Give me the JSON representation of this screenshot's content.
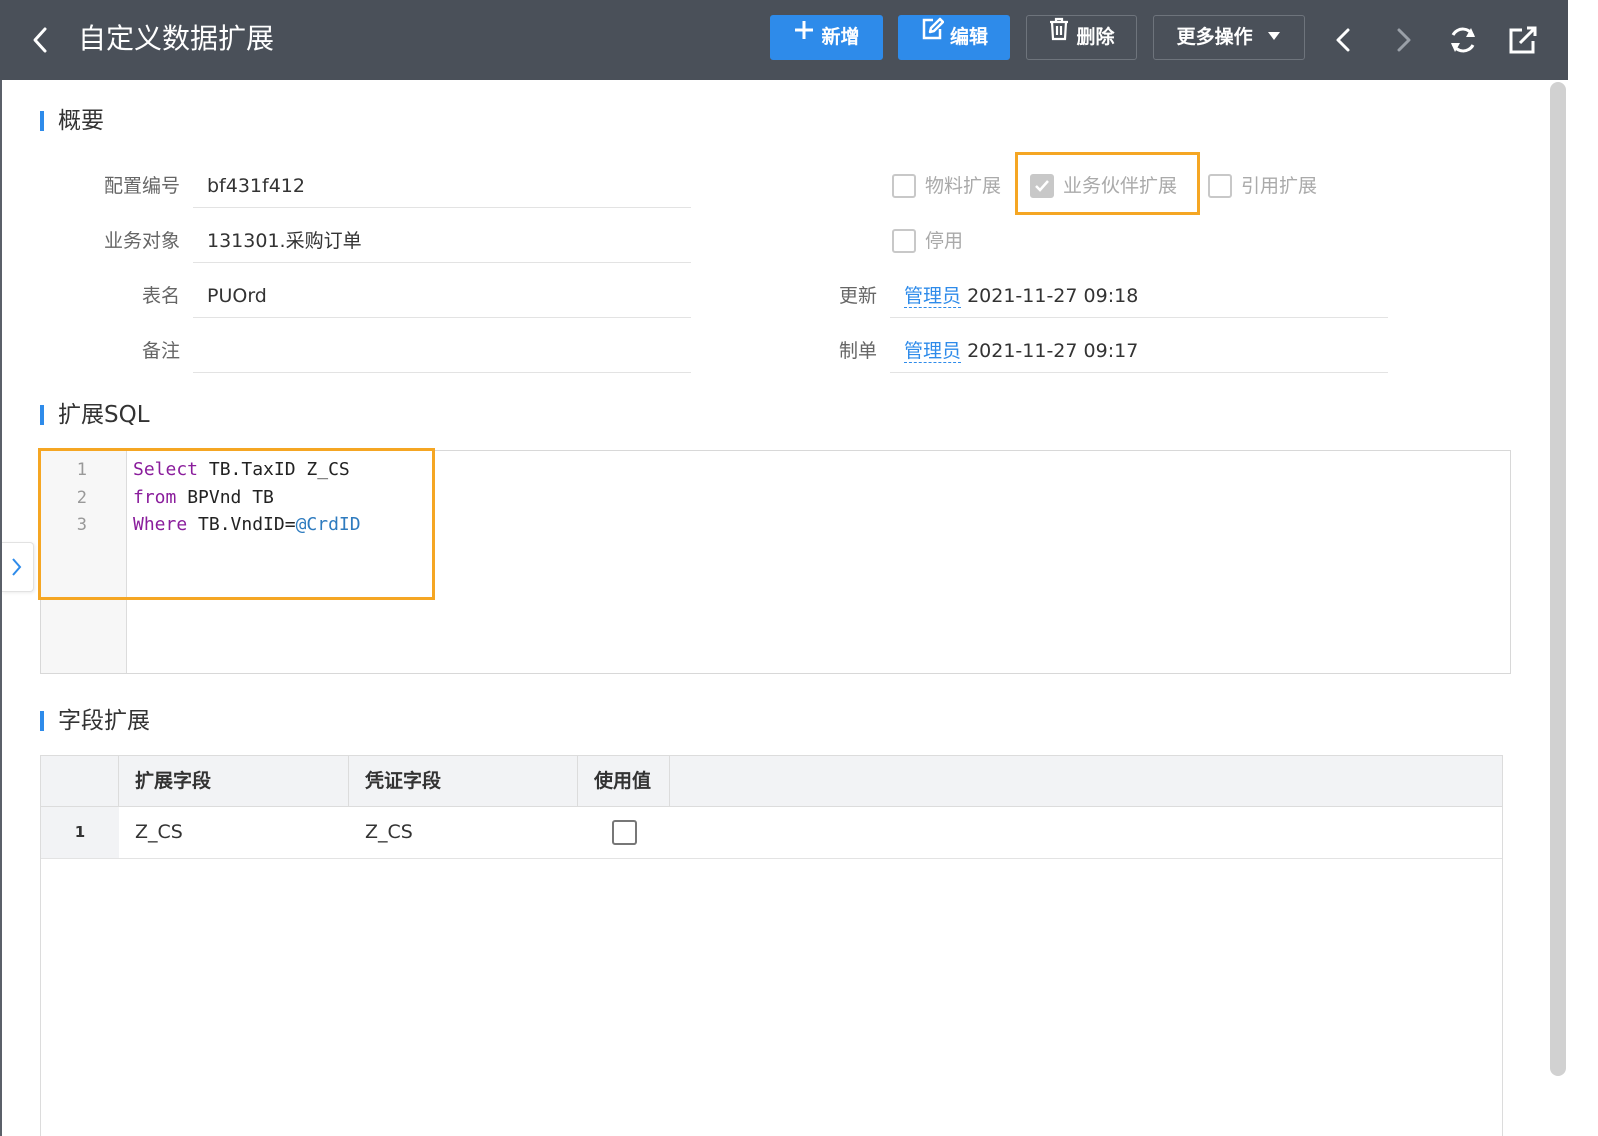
{
  "header": {
    "title": "自定义数据扩展",
    "buttons": {
      "add": "新增",
      "edit": "编辑",
      "delete": "删除",
      "more": "更多操作"
    }
  },
  "overview": {
    "section_title": "概要",
    "fields": {
      "config_no_label": "配置编号",
      "config_no_value": "bf431f412",
      "biz_object_label": "业务对象",
      "biz_object_value": "131301.采购订单",
      "table_name_label": "表名",
      "table_name_value": "PUOrd",
      "remark_label": "备注",
      "remark_value": ""
    },
    "checkboxes": {
      "material_ext": {
        "label": "物料扩展",
        "checked": false
      },
      "partner_ext": {
        "label": "业务伙伴扩展",
        "checked": true
      },
      "ref_ext": {
        "label": "引用扩展",
        "checked": false
      },
      "disabled": {
        "label": "停用",
        "checked": false
      }
    },
    "updated": {
      "label": "更新",
      "user": "管理员",
      "time": "2021-11-27 09:18"
    },
    "created": {
      "label": "制单",
      "user": "管理员",
      "time": "2021-11-27 09:17"
    }
  },
  "sql": {
    "section_title": "扩展SQL",
    "line_numbers": [
      "1",
      "2",
      "3"
    ],
    "lines": [
      {
        "kw": "Select",
        "rest": " TB.TaxID Z_CS",
        "var": ""
      },
      {
        "kw": "from",
        "rest": " BPVnd TB",
        "var": ""
      },
      {
        "kw": "Where",
        "rest": " TB.VndID=",
        "var": "@CrdID"
      }
    ]
  },
  "fields_ext": {
    "section_title": "字段扩展",
    "columns": [
      "扩展字段",
      "凭证字段",
      "使用值"
    ],
    "rows": [
      {
        "num": "1",
        "ext_field": "Z_CS",
        "voucher_field": "Z_CS",
        "use_value": false
      }
    ]
  },
  "colors": {
    "header_bg": "#4a5059",
    "primary": "#2e8bea",
    "highlight": "#f5a623"
  }
}
